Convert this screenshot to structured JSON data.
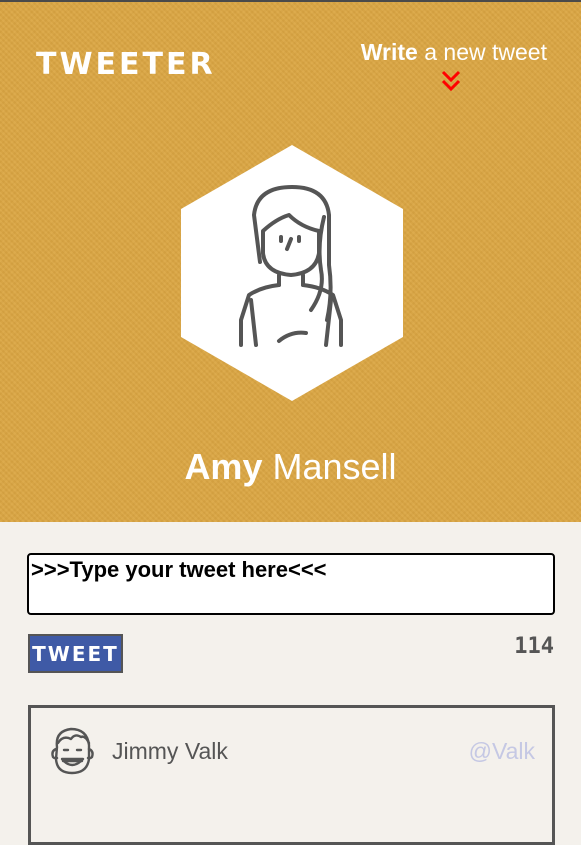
{
  "header": {
    "brand": "TWEETER",
    "write_bold": "Write",
    "write_rest": " a new tweet",
    "chevron_icon": "double-chevron-down-icon",
    "chevron_color": "#ff0000",
    "background_color": "#dba643"
  },
  "profile": {
    "avatar_icon": "woman-avatar-icon",
    "first_name": "Amy",
    "last_name": "Mansell"
  },
  "compose": {
    "placeholder": ">>>Type your tweet here<<<",
    "button_label": "TWEET",
    "char_counter": "114"
  },
  "tweets": [
    {
      "avatar_icon": "smiling-man-avatar-icon",
      "name": "Jimmy Valk",
      "handle": "@Valk"
    }
  ]
}
